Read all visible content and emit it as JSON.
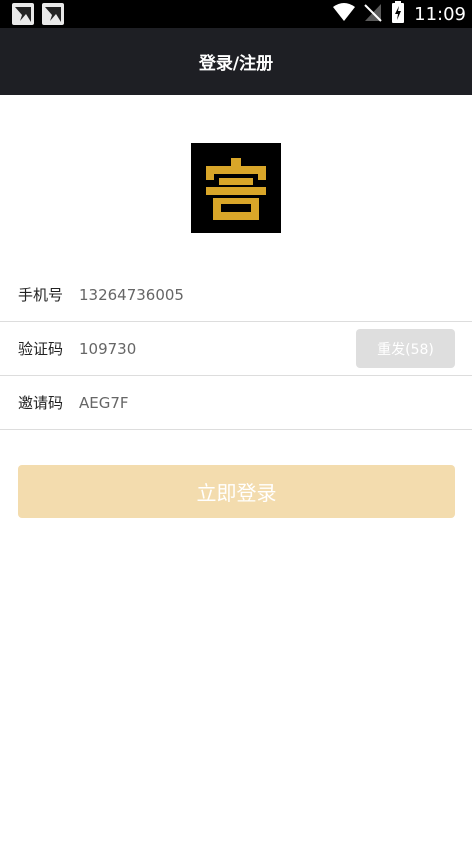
{
  "status_bar": {
    "time": "11:09",
    "notification_icons": [
      "app-notification-icon",
      "app-notification-icon"
    ],
    "system_icons": [
      "wifi-icon",
      "no-signal-icon",
      "battery-charging-icon"
    ]
  },
  "header": {
    "title": "登录/注册"
  },
  "logo": {
    "glyph": "客",
    "colors": {
      "background": "#000000",
      "gold": "#d9a629"
    }
  },
  "form": {
    "phone": {
      "label": "手机号",
      "value": "13264736005"
    },
    "code": {
      "label": "验证码",
      "value": "109730",
      "resend_label": "重发(58)"
    },
    "invite": {
      "label": "邀请码",
      "value": "AEG7F"
    },
    "submit_label": "立即登录"
  },
  "colors": {
    "header_bg": "#1e1f24",
    "submit_bg": "#f3dcae",
    "resend_bg": "#dedede"
  }
}
